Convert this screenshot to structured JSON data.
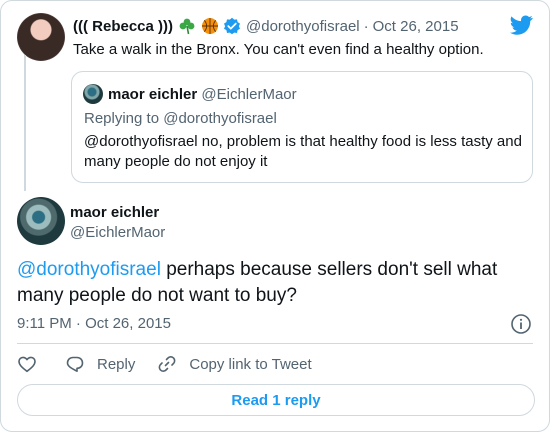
{
  "parent_tweet": {
    "display_name": "((( Rebecca )))",
    "emoji": [
      "shamrock-icon",
      "basketball-icon"
    ],
    "handle": "@dorothyofisrael",
    "separator": "·",
    "date": "Oct 26, 2015",
    "text": "Take a walk in the Bronx. You can't even find a healthy option."
  },
  "quoted_tweet": {
    "display_name": "maor eichler",
    "handle": "@EichlerMaor",
    "replying_to": "Replying to @dorothyofisrael",
    "text": "@dorothyofisrael no, problem is that healthy food is less tasty and many people do not enjoy it"
  },
  "main_tweet": {
    "display_name": "maor eichler",
    "handle": "@EichlerMaor",
    "mention": "@dorothyofisrael",
    "text_rest": " perhaps because sellers don't sell what many people do not want to buy?",
    "timestamp": "9:11 PM · Oct 26, 2015"
  },
  "actions": {
    "reply_label": "Reply",
    "copy_label": "Copy link to Tweet"
  },
  "read_replies_label": "Read 1 reply",
  "colors": {
    "accent": "#1d9bf0",
    "muted": "#536471",
    "border": "#cfd9de",
    "text": "#0f1419"
  }
}
